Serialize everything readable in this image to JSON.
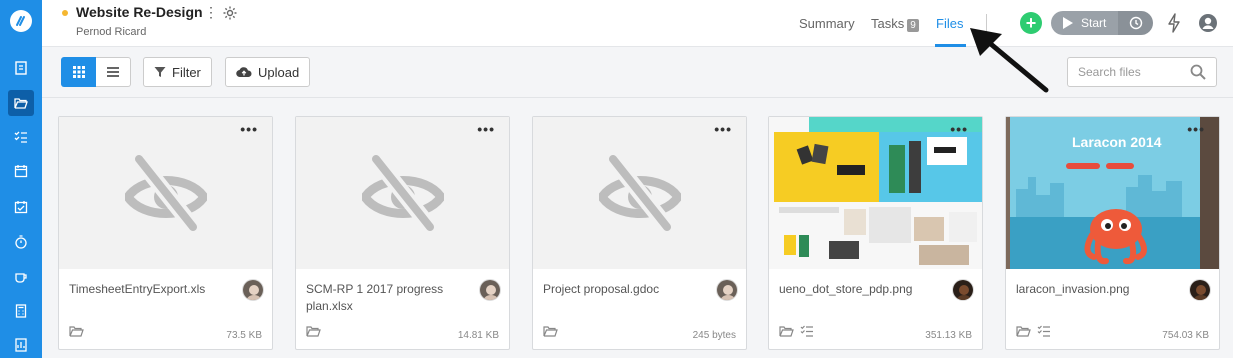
{
  "colors": {
    "brand": "#1f8ee6",
    "project_dot": "#f5b731",
    "add": "#2ecc71"
  },
  "sidebar": {
    "items": [
      {
        "icon": "document-icon"
      },
      {
        "icon": "folder-open-icon",
        "active": true
      },
      {
        "icon": "task-list-icon"
      },
      {
        "icon": "calendar-icon"
      },
      {
        "icon": "calendar-check-icon"
      },
      {
        "icon": "stopwatch-icon"
      },
      {
        "icon": "coffee-cup-icon"
      },
      {
        "icon": "calculator-icon"
      },
      {
        "icon": "report-icon"
      }
    ]
  },
  "header": {
    "project_title": "Website Re-Design",
    "client": "Pernod Ricard",
    "more": "⋮",
    "tabs": [
      {
        "label": "Summary"
      },
      {
        "label": "Tasks",
        "badge": "9"
      },
      {
        "label": "Files",
        "active": true
      }
    ],
    "add_label": "+",
    "start_label": "Start"
  },
  "toolbar": {
    "filter_label": "Filter",
    "upload_label": "Upload",
    "search_placeholder": "Search files"
  },
  "files": [
    {
      "name": "TimesheetEntryExport.xls",
      "size": "73.5 KB",
      "preview": "none",
      "more": "•••"
    },
    {
      "name": "SCM-RP 1 2017 progress plan.xlsx",
      "size": "14.81 KB",
      "preview": "none",
      "more": "•••"
    },
    {
      "name": "Project proposal.gdoc",
      "size": "245 bytes",
      "preview": "none",
      "more": "•••"
    },
    {
      "name": "ueno_dot_store_pdp.png",
      "size": "351.13 KB",
      "preview": "store-design",
      "more": "•••"
    },
    {
      "name": "laracon_invasion.png",
      "size": "754.03 KB",
      "preview": "laracon-poster",
      "more": "•••",
      "preview_text": "Laracon 2014"
    }
  ]
}
